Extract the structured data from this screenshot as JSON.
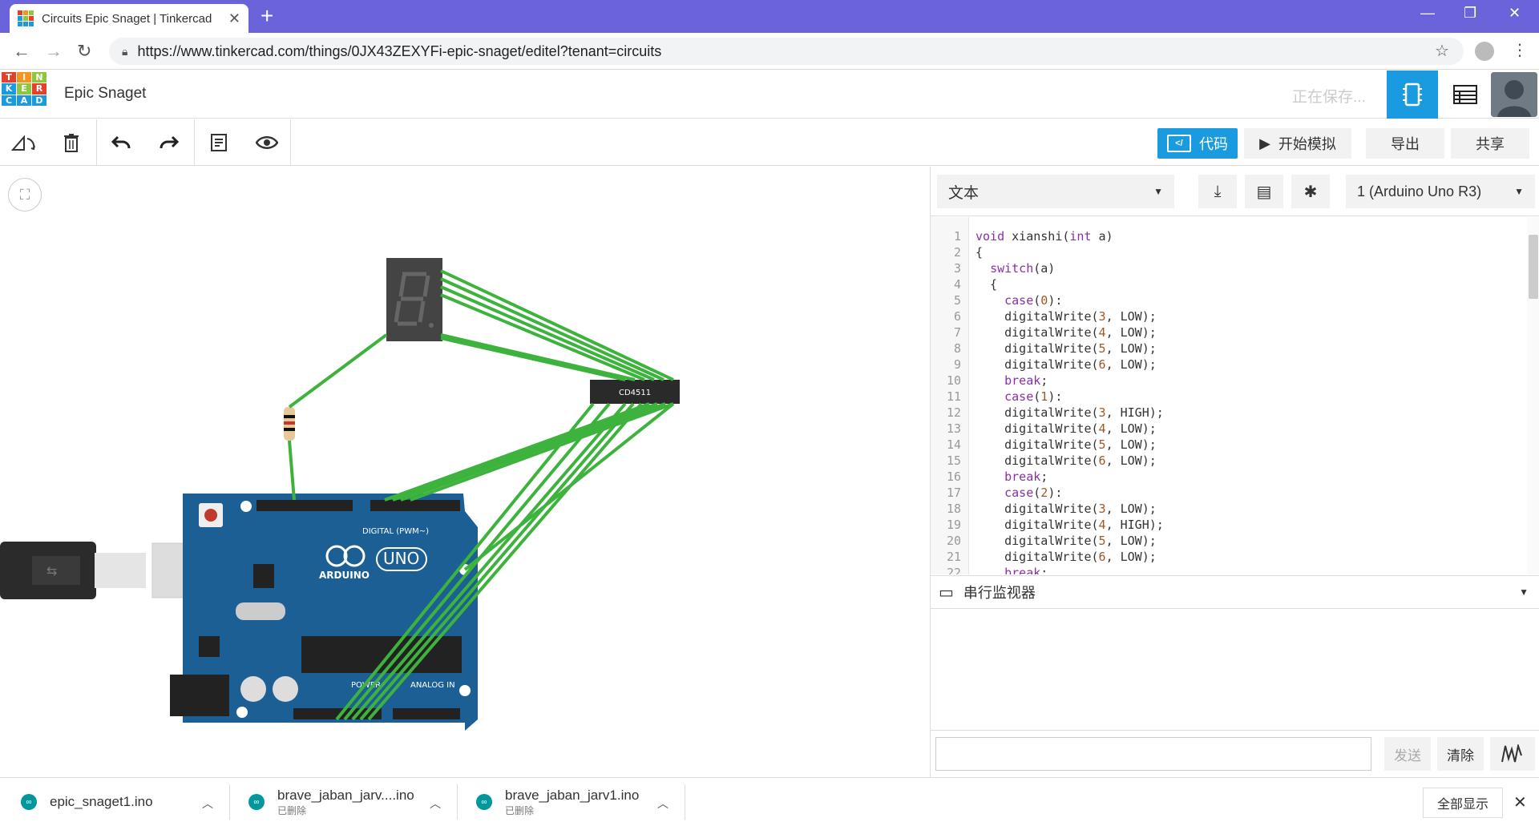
{
  "browser": {
    "tab_title": "Circuits Epic Snaget | Tinkercad",
    "tab_close": "✕",
    "new_tab": "+",
    "url": "https://www.tinkercad.com/things/0JX43ZEXYFi-epic-snaget/editel?tenant=circuits",
    "minimize": "—",
    "maximize": "❐",
    "close": "✕"
  },
  "app": {
    "logo_letters": [
      "T",
      "I",
      "N",
      "K",
      "E",
      "R",
      "C",
      "A",
      "D"
    ],
    "project_name": "Epic Snaget",
    "saving_status": "正在保存..."
  },
  "toolbar": {
    "code_button": "代码",
    "code_icon_text": "</",
    "simulate_button": "开始模拟",
    "export_button": "导出",
    "share_button": "共享"
  },
  "code_panel": {
    "mode": "文本",
    "board": "1 (Arduino Uno R3)",
    "lines": [
      {
        "n": "1",
        "text": "void xianshi(int a)"
      },
      {
        "n": "2",
        "text": "{"
      },
      {
        "n": "3",
        "text": "  switch(a)"
      },
      {
        "n": "4",
        "text": "  {"
      },
      {
        "n": "5",
        "text": "    case(0):"
      },
      {
        "n": "6",
        "text": "    digitalWrite(3, LOW);"
      },
      {
        "n": "7",
        "text": "    digitalWrite(4, LOW);"
      },
      {
        "n": "8",
        "text": "    digitalWrite(5, LOW);"
      },
      {
        "n": "9",
        "text": "    digitalWrite(6, LOW);"
      },
      {
        "n": "10",
        "text": "    break;"
      },
      {
        "n": "11",
        "text": "    case(1):"
      },
      {
        "n": "12",
        "text": "    digitalWrite(3, HIGH);"
      },
      {
        "n": "13",
        "text": "    digitalWrite(4, LOW);"
      },
      {
        "n": "14",
        "text": "    digitalWrite(5, LOW);"
      },
      {
        "n": "15",
        "text": "    digitalWrite(6, LOW);"
      },
      {
        "n": "16",
        "text": "    break;"
      },
      {
        "n": "17",
        "text": "    case(2):"
      },
      {
        "n": "18",
        "text": "    digitalWrite(3, LOW);"
      },
      {
        "n": "19",
        "text": "    digitalWrite(4, HIGH);"
      },
      {
        "n": "20",
        "text": "    digitalWrite(5, LOW);"
      },
      {
        "n": "21",
        "text": "    digitalWrite(6, LOW);"
      },
      {
        "n": "22",
        "text": "    break;"
      }
    ],
    "serial_monitor_label": "串行监视器",
    "send_button": "发送",
    "clear_button": "清除"
  },
  "circuit": {
    "chip_label": "CD4511",
    "board_brand": "ARDUINO",
    "board_model": "UNO",
    "digital_label": "DIGITAL (PWM~)",
    "power_label": "POWER",
    "analog_label": "ANALOG IN",
    "wire_color": "#3db33d",
    "board_color": "#1c5f94"
  },
  "downloads": [
    {
      "name": "epic_snaget1.ino",
      "sub": ""
    },
    {
      "name": "brave_jaban_jarv....ino",
      "sub": "已删除"
    },
    {
      "name": "brave_jaban_jarv1.ino",
      "sub": "已删除"
    }
  ],
  "downloads_show_all": "全部显示",
  "downloads_close": "✕"
}
